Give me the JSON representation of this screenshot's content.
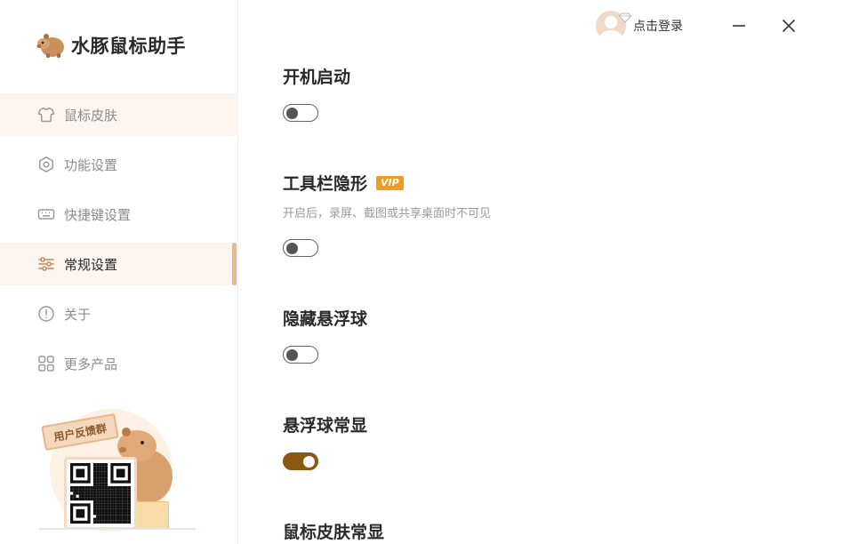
{
  "app": {
    "title": "水豚鼠标助手"
  },
  "sidebar": {
    "items": [
      {
        "label": "鼠标皮肤",
        "icon": "tshirt-icon",
        "state": "hover"
      },
      {
        "label": "功能设置",
        "icon": "hexagon-settings-icon",
        "state": ""
      },
      {
        "label": "快捷键设置",
        "icon": "keyboard-icon",
        "state": ""
      },
      {
        "label": "常规设置",
        "icon": "sliders-icon",
        "state": "active"
      },
      {
        "label": "关于",
        "icon": "info-circle-icon",
        "state": ""
      },
      {
        "label": "更多产品",
        "icon": "grid-icon",
        "state": ""
      }
    ],
    "feedback": {
      "label": "用户反馈群"
    }
  },
  "topbar": {
    "login_label": "点击登录",
    "minimize_icon": "minimize-icon",
    "close_icon": "close-icon"
  },
  "settings": [
    {
      "title": "开机启动",
      "enabled": false
    },
    {
      "title": "工具栏隐形",
      "badge": "VIP",
      "description": "开启后，录屏、截图或共享桌面时不可见",
      "enabled": false
    },
    {
      "title": "隐藏悬浮球",
      "enabled": false
    },
    {
      "title": "悬浮球常显",
      "enabled": true
    },
    {
      "title": "鼠标皮肤常显"
    }
  ],
  "colors": {
    "accent": "#e9b98d",
    "toggle_on": "#8a5a12",
    "vip": "#f29b22",
    "hover_bg": "#fbf4ef"
  }
}
